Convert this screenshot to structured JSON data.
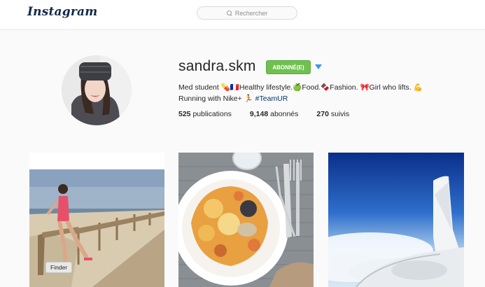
{
  "header": {
    "logo": "Instagram",
    "search_placeholder": "Rechercher"
  },
  "profile": {
    "username": "sandra.skm",
    "follow_label": "ABONNÉ(E)",
    "bio_line1": "Med student 💊🇫🇷Healthy lifestyle.🍏Food.🍫Fashion. 🎀Girl who lifts. 💪",
    "bio_line2_text": "Running with Nike+ 🏃",
    "bio_tag": "#TeamUR",
    "stats": {
      "posts": "525",
      "posts_label": "publications",
      "followers": "9,148",
      "followers_label": "abonnés",
      "following": "270",
      "following_label": "suivis"
    }
  },
  "dock": {
    "tooltip": "Finder"
  },
  "colors": {
    "accent_green": "#70c050",
    "link_blue": "#3897f0",
    "logo_navy": "#12294a"
  }
}
